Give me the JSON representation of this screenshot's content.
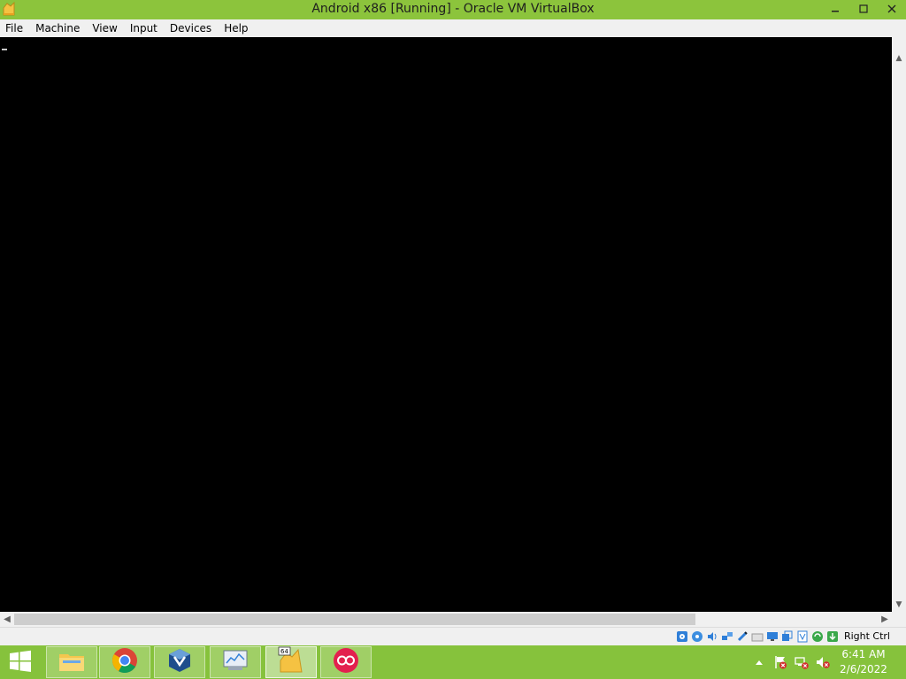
{
  "window": {
    "title": "Android x86 [Running] - Oracle VM VirtualBox",
    "app_icon": "virtualbox-vm-icon"
  },
  "window_controls": {
    "minimize_icon": "minimize-icon",
    "maximize_icon": "maximize-icon",
    "close_icon": "close-icon"
  },
  "menu": {
    "items": [
      "File",
      "Machine",
      "View",
      "Input",
      "Devices",
      "Help"
    ]
  },
  "vm_screen": {
    "background": "#000000",
    "cursor_glyph": "_"
  },
  "status_bar": {
    "icons": [
      "hard-disk-icon",
      "optical-drive-icon",
      "audio-icon",
      "network-icon",
      "usb-icon",
      "shared-folders-icon",
      "display-icon",
      "video-capture-icon",
      "cpu-icon",
      "mouse-integration-icon",
      "keyboard-capture-icon"
    ],
    "host_key": "Right Ctrl"
  },
  "taskbar": {
    "start_icon": "windows-start-icon",
    "apps": [
      {
        "name": "File Explorer",
        "icon": "file-explorer-icon"
      },
      {
        "name": "Google Chrome",
        "icon": "chrome-icon"
      },
      {
        "name": "Oracle VM VirtualBox",
        "icon": "virtualbox-icon"
      },
      {
        "name": "VirtualBox Manager",
        "icon": "vbox-manager-icon"
      },
      {
        "name": "Android x86 VM",
        "icon": "android-vm-icon",
        "active": true,
        "badge": "64"
      },
      {
        "name": "App",
        "icon": "red-circle-app-icon"
      }
    ],
    "tray": {
      "show_hidden_icon": "chevron-up-icon",
      "action_center_icon": "flag-alert-icon",
      "network_icon": "network-alert-icon",
      "volume_icon": "volume-muted-icon",
      "time": "6:41 AM",
      "date": "2/6/2022"
    }
  },
  "colors": {
    "accent_green": "#8cc43c",
    "taskbar_green": "#86c23c",
    "chrome_bg": "#f0f0f0"
  }
}
